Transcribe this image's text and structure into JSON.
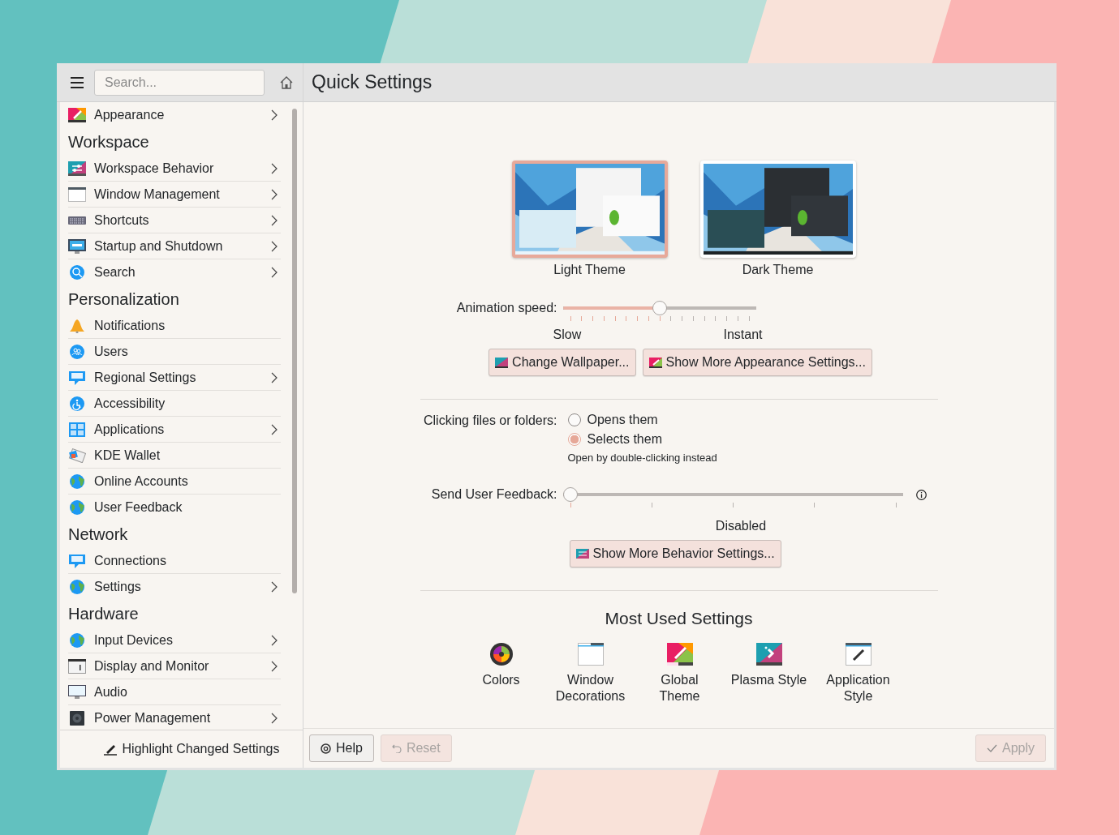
{
  "sidebar": {
    "search": {
      "placeholder": "Search..."
    },
    "sections": [
      {
        "items": [
          {
            "label": "Appearance",
            "has_children": true
          }
        ]
      },
      {
        "title": "Workspace",
        "items": [
          {
            "label": "Workspace Behavior",
            "has_children": true
          },
          {
            "label": "Window Management",
            "has_children": true
          },
          {
            "label": "Shortcuts",
            "has_children": true
          },
          {
            "label": "Startup and Shutdown",
            "has_children": true
          },
          {
            "label": "Search",
            "has_children": true
          }
        ]
      },
      {
        "title": "Personalization",
        "items": [
          {
            "label": "Notifications",
            "has_children": false
          },
          {
            "label": "Users",
            "has_children": false
          },
          {
            "label": "Regional Settings",
            "has_children": true
          },
          {
            "label": "Accessibility",
            "has_children": false
          },
          {
            "label": "Applications",
            "has_children": true
          },
          {
            "label": "KDE Wallet",
            "has_children": false
          },
          {
            "label": "Online Accounts",
            "has_children": false
          },
          {
            "label": "User Feedback",
            "has_children": false
          }
        ]
      },
      {
        "title": "Network",
        "items": [
          {
            "label": "Connections",
            "has_children": false
          },
          {
            "label": "Settings",
            "has_children": true
          }
        ]
      },
      {
        "title": "Hardware",
        "items": [
          {
            "label": "Input Devices",
            "has_children": true
          },
          {
            "label": "Display and Monitor",
            "has_children": true
          },
          {
            "label": "Audio",
            "has_children": false
          },
          {
            "label": "Power Management",
            "has_children": true
          }
        ]
      }
    ],
    "footer_button": "Highlight Changed Settings"
  },
  "page": {
    "title": "Quick Settings",
    "themes": [
      {
        "label": "Light Theme",
        "selected": true
      },
      {
        "label": "Dark Theme",
        "selected": false
      }
    ],
    "animation_speed": {
      "label": "Animation speed:",
      "level": 0.5,
      "min_label": "Slow",
      "max_label": "Instant"
    },
    "appearance_buttons": [
      "Change Wallpaper...",
      "Show More Appearance Settings..."
    ],
    "clicking": {
      "label": "Clicking files or folders:",
      "options": [
        {
          "label": "Opens them",
          "selected": false
        },
        {
          "label": "Selects them",
          "selected": true
        }
      ],
      "hint": "Open by double-clicking instead"
    },
    "feedback": {
      "label": "Send User Feedback:",
      "level": 0,
      "reading": "Disabled"
    },
    "behavior_button": "Show More Behavior Settings...",
    "most_used": {
      "title": "Most Used Settings",
      "items": [
        "Colors",
        "Window\nDecorations",
        "Global\nTheme",
        "Plasma Style",
        "Application\nStyle"
      ]
    }
  },
  "buttons": [
    {
      "label": "Help",
      "disabled": false
    },
    {
      "label": "Reset",
      "disabled": true
    },
    {
      "label": "Apply",
      "disabled": true
    }
  ]
}
